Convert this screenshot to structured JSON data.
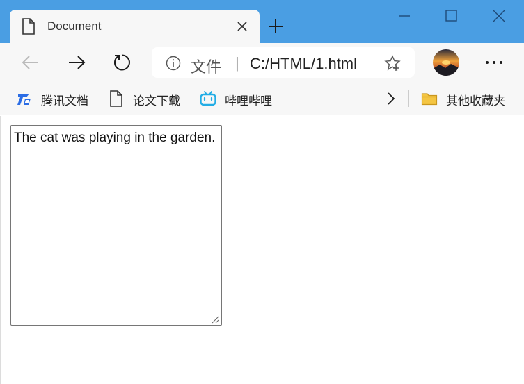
{
  "tab": {
    "title": "Document",
    "icon": "document-icon"
  },
  "window_controls": [
    "minimize-icon",
    "maximize-icon",
    "close-icon"
  ],
  "nav": {
    "back_icon": "back-arrow-icon",
    "forward_icon": "forward-arrow-icon",
    "refresh_icon": "refresh-icon",
    "address": {
      "scheme_label": "文件",
      "separator": "|",
      "url": "C:/HTML/1.html"
    },
    "more_icon": "more-icon"
  },
  "bookmarks": {
    "items": [
      {
        "label": "腾讯文档",
        "icon": "tencent-docs-icon"
      },
      {
        "label": "论文下载",
        "icon": "document-icon"
      },
      {
        "label": "哔哩哔哩",
        "icon": "bilibili-icon"
      }
    ],
    "overflow_icon": "chevron-right-icon",
    "other": {
      "label": "其他收藏夹",
      "icon": "folder-icon"
    }
  },
  "page": {
    "textarea_value": "The cat was playing in the garden."
  },
  "colors": {
    "titlebar": "#4a9ee3",
    "toolbar": "#f7f7f7",
    "bilibili": "#23ade5",
    "tencent": "#2b6de5",
    "folder": "#f4c542"
  }
}
